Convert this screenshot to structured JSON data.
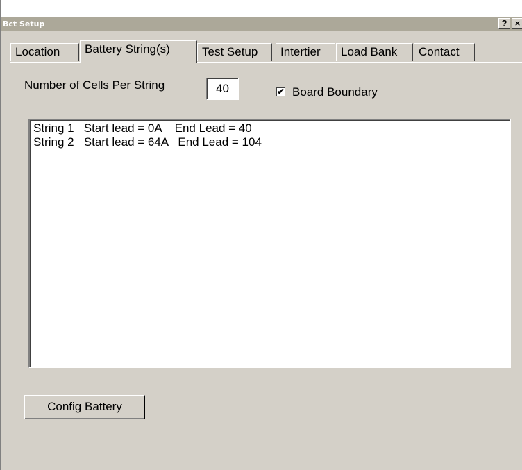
{
  "window": {
    "title": "Bct Setup",
    "help_label": "?",
    "close_label": "×"
  },
  "tabs": [
    {
      "label": "Location"
    },
    {
      "label": "Battery String(s)",
      "active": true
    },
    {
      "label": "Test Setup"
    },
    {
      "label": "Intertier"
    },
    {
      "label": "Load Bank"
    },
    {
      "label": "Contact"
    }
  ],
  "cells": {
    "label": "Number of Cells Per String",
    "value": "40"
  },
  "board_boundary": {
    "label": "Board Boundary",
    "checked": true,
    "check_glyph": "✔"
  },
  "strings": [
    "String 1   Start lead = 0A    End Lead = 40",
    "String 2   Start lead = 64A   End Lead = 104"
  ],
  "config_button": "Config Battery"
}
